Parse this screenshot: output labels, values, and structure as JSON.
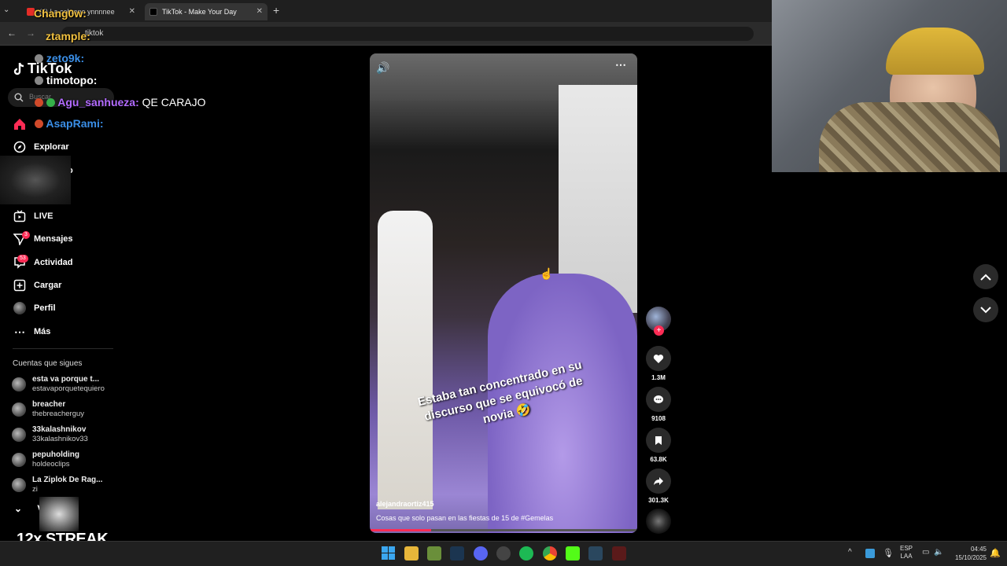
{
  "browser": {
    "tabs": [
      {
        "label": "(4) La cabrona ynnnnee",
        "active": false
      },
      {
        "label": "TikTok - Make Your Day",
        "active": true
      }
    ],
    "new_tab": "+",
    "address_partial": "tiktok"
  },
  "tiktok": {
    "logo": "TikTok",
    "search_placeholder": "Buscar",
    "nav": [
      {
        "label": "",
        "icon": "home-icon",
        "active": true
      },
      {
        "label": "Explorar",
        "icon": "compass-icon"
      },
      {
        "label": "o",
        "icon": "people-icon"
      },
      {
        "label": "LIVE",
        "icon": "live-icon"
      },
      {
        "label": "Mensajes",
        "icon": "send-icon",
        "badge": "3"
      },
      {
        "label": "Actividad",
        "icon": "inbox-icon",
        "badge": "53"
      },
      {
        "label": "Cargar",
        "icon": "plus-square-icon"
      },
      {
        "label": "Perfil",
        "icon": "avatar"
      },
      {
        "label": "Más",
        "icon": "more-icon"
      }
    ],
    "following_title": "Cuentas que sigues",
    "following": [
      {
        "name": "esta va porque t...",
        "user": "estavaporquetequiero"
      },
      {
        "name": "breacher",
        "user": "thebreacherguy"
      },
      {
        "name": "33kalashnikov",
        "user": "33kalashnikov33"
      },
      {
        "name": "pepuholding",
        "user": "holdeoclips"
      },
      {
        "name": "La Ziplok De Rag...",
        "user": "zi"
      }
    ],
    "see_more": "V"
  },
  "video": {
    "caption_overlay": "Estaba tan concentrado en su discurso que se equivocó de novia 🤣",
    "author": "alejandraortiz415",
    "description": "Cosas que solo pasan en las fiestas de 15 de #Gemelas",
    "progress_fraction": 0.23,
    "likes": "1.3M",
    "comments": "9108",
    "saves": "63.8K",
    "shares": "301.3K"
  },
  "chat": [
    {
      "user": "Chang0w:",
      "msg": "",
      "color": "#f0c040"
    },
    {
      "user": "ztample:",
      "msg": "",
      "color": "#f0c040"
    },
    {
      "user": "zeto9k:",
      "msg": "",
      "color": "#3a8ee6"
    },
    {
      "user": "timotopo:",
      "msg": "",
      "color": "#ffffff"
    },
    {
      "user": "Agu_sanhueza:",
      "msg": "QE CARAJO",
      "color": "#b36bff"
    },
    {
      "user": "AsapRami:",
      "msg": "",
      "color": "#3a8ee6"
    }
  ],
  "streak": "12x STREAK",
  "taskbar": {
    "lang_top": "ESP",
    "lang_bottom": "LAA",
    "time": "04:45",
    "date": "15/10/2025"
  }
}
